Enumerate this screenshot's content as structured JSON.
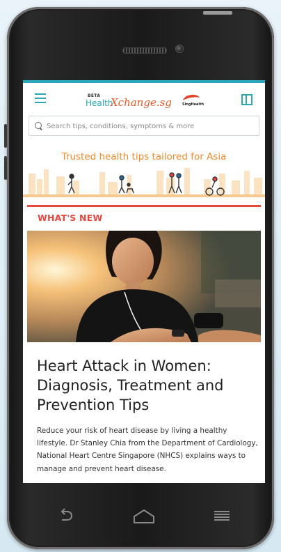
{
  "header": {
    "logo_beta": "BETA",
    "logo_health": "Health",
    "logo_x": "Xchange.sg",
    "partner_logo_text": "SingHealth"
  },
  "search": {
    "placeholder": "Search tips, conditions, symptoms & more"
  },
  "banner": {
    "tagline": "Trusted health tips tailored for Asia"
  },
  "section": {
    "label": "WHAT'S NEW"
  },
  "article": {
    "title": "Heart Attack in Women: Diagnosis, Treatment and Prevention Tips",
    "description": "Reduce your risk of heart disease by living a healthy lifestyle. Dr Stanley Chia from the Department of Cardiology, National Heart Centre Singapore (NHCS) explains ways to manage and prevent heart disease."
  },
  "icons": {
    "menu": "hamburger-menu-icon",
    "panel": "panel-icon",
    "search": "search-icon",
    "back": "back-icon",
    "home": "home-icon",
    "recents": "recents-icon"
  },
  "colors": {
    "brand_teal": "#2aa6b5",
    "accent_red": "#e8453c",
    "tagline_orange": "#f08a2c"
  }
}
